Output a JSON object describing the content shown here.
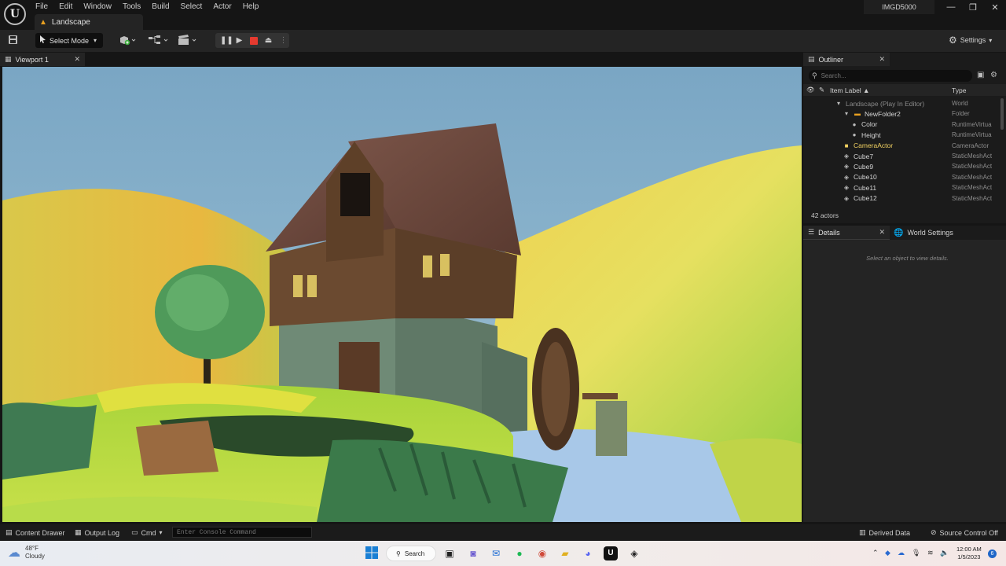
{
  "menubar": {
    "logo": "U",
    "items": [
      "File",
      "Edit",
      "Window",
      "Tools",
      "Build",
      "Select",
      "Actor",
      "Help"
    ],
    "level_tab": "Landscape",
    "project_name": "IMGD5000",
    "window_controls": {
      "minimize": "—",
      "maximize": "❐",
      "close": "✕"
    }
  },
  "toolbar": {
    "select_mode_label": "Select Mode",
    "settings_label": "Settings",
    "icons": [
      "save-icon",
      "add-actor-icon",
      "blueprint-icon",
      "cinematics-icon",
      "pause-icon",
      "skip-frame-icon",
      "stop-icon",
      "eject-icon"
    ]
  },
  "viewport": {
    "tab_label": "Viewport 1"
  },
  "outliner": {
    "tab_label": "Outliner",
    "search_placeholder": "Search...",
    "col_label": "Item Label ▲",
    "col_type": "Type",
    "rows": [
      {
        "label": "Landscape (Play In Editor)",
        "type": "World",
        "indent": 0,
        "icon": "▾",
        "dim": true
      },
      {
        "label": "NewFolder2",
        "type": "Folder",
        "indent": 1,
        "icon": "▾"
      },
      {
        "label": "Color",
        "type": "RuntimeVirtua",
        "indent": 2
      },
      {
        "label": "Height",
        "type": "RuntimeVirtua",
        "indent": 2
      },
      {
        "label": "CameraActor",
        "type": "CameraActor",
        "indent": 1,
        "highlight": true
      },
      {
        "label": "Cube7",
        "type": "StaticMeshAct",
        "indent": 1
      },
      {
        "label": "Cube9",
        "type": "StaticMeshAct",
        "indent": 1
      },
      {
        "label": "Cube10",
        "type": "StaticMeshAct",
        "indent": 1
      },
      {
        "label": "Cube11",
        "type": "StaticMeshAct",
        "indent": 1
      },
      {
        "label": "Cube12",
        "type": "StaticMeshAct",
        "indent": 1
      }
    ],
    "actor_count": "42 actors"
  },
  "details": {
    "tab_label": "Details",
    "world_settings_label": "World Settings",
    "empty_message": "Select an object to view details."
  },
  "statusbar": {
    "content_drawer": "Content Drawer",
    "output_log": "Output Log",
    "cmd": "Cmd",
    "console_placeholder": "Enter Console Command",
    "derived_data": "Derived Data",
    "source_control": "Source Control Off"
  },
  "taskbar": {
    "weather_temp": "48°F",
    "weather_desc": "Cloudy",
    "search_label": "Search",
    "time": "12:00 AM",
    "date": "1/5/2023",
    "notification_count": "6"
  },
  "colors": {
    "accent_orange": "#e8a020",
    "stop_red": "#e53a2f",
    "camera_yellow": "#f0d060"
  }
}
